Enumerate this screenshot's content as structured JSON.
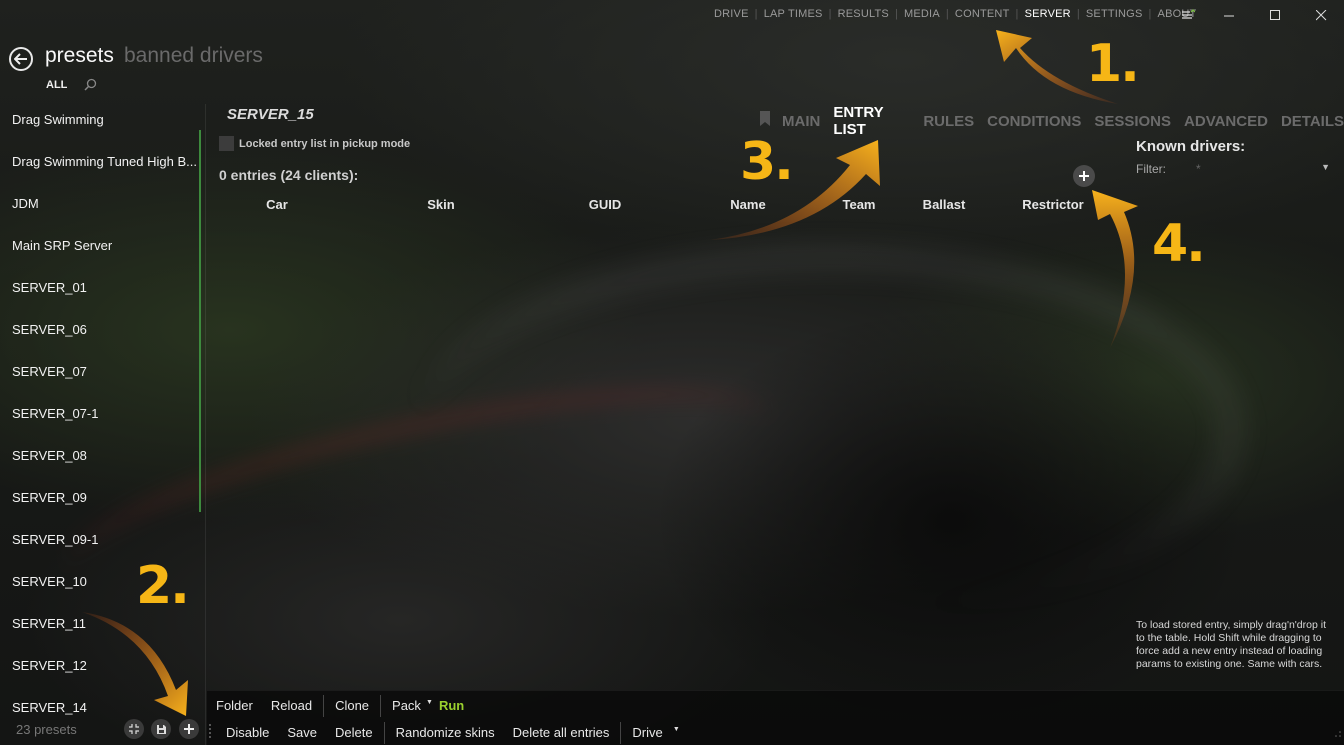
{
  "nav": {
    "items": [
      {
        "label": "DRIVE",
        "active": false
      },
      {
        "label": "LAP TIMES",
        "active": false
      },
      {
        "label": "RESULTS",
        "active": false
      },
      {
        "label": "MEDIA",
        "active": false
      },
      {
        "label": "CONTENT",
        "active": false
      },
      {
        "label": "SERVER",
        "active": true
      },
      {
        "label": "SETTINGS",
        "active": false
      },
      {
        "label": "ABOUT",
        "active": false
      }
    ]
  },
  "header": {
    "title": "presets",
    "subtitle": "banned drivers",
    "filter_all": "ALL"
  },
  "presets": {
    "items": [
      "Drag Swimming",
      "Drag Swimming Tuned High B...",
      "JDM",
      "Main SRP Server",
      "SERVER_01",
      "SERVER_06",
      "SERVER_07",
      "SERVER_07-1",
      "SERVER_08",
      "SERVER_09",
      "SERVER_09-1",
      "SERVER_10",
      "SERVER_11",
      "SERVER_12",
      "SERVER_14"
    ],
    "count_label": "23 presets"
  },
  "main": {
    "server_name": "SERVER_15",
    "tabs": [
      {
        "label": "MAIN",
        "active": false
      },
      {
        "label": "ENTRY LIST",
        "active": true
      },
      {
        "label": "RULES",
        "active": false
      },
      {
        "label": "CONDITIONS",
        "active": false
      },
      {
        "label": "SESSIONS",
        "active": false
      },
      {
        "label": "ADVANCED",
        "active": false
      },
      {
        "label": "DETAILS",
        "active": false
      }
    ],
    "locked_label": "Locked entry list in pickup mode",
    "entries_title": "0 entries (24 clients):",
    "columns": [
      "Car",
      "Skin",
      "GUID",
      "Name",
      "Team",
      "Ballast",
      "Restrictor"
    ]
  },
  "known_drivers": {
    "title": "Known drivers:",
    "filter_label": "Filter:",
    "filter_value": "*",
    "hint": "To load stored entry, simply drag'n'drop it to the table. Hold Shift while dragging to force add a new entry instead of loading params to existing one. Same with cars."
  },
  "toolbar": {
    "row1": {
      "folder": "Folder",
      "reload": "Reload",
      "clone": "Clone",
      "pack": "Pack",
      "run": "Run"
    },
    "row2": {
      "disable": "Disable",
      "save": "Save",
      "delete": "Delete",
      "randomize": "Randomize skins",
      "delete_all": "Delete all entries",
      "drive": "Drive"
    }
  },
  "annotations": [
    "1.",
    "2.",
    "3.",
    "4."
  ],
  "colors": {
    "accent_run": "#9ad02e",
    "annotation": "#f6b616",
    "scroll_indicator": "#3d8a3d"
  }
}
